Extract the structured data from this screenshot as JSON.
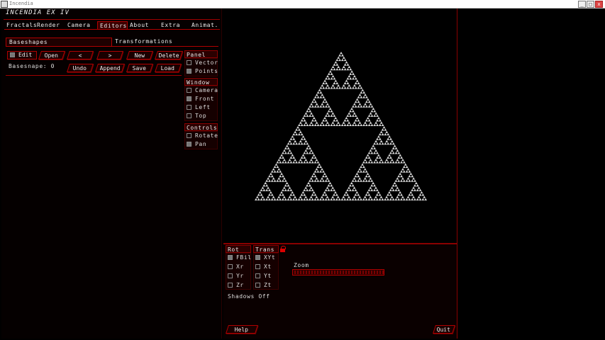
{
  "window": {
    "title": "Incendia",
    "btn_min": "_",
    "btn_max": "□",
    "btn_close": "x"
  },
  "app_title": "INCENDIA EX IV",
  "tabs": [
    "Fractals",
    "Render",
    "Camera",
    "Editors",
    "About",
    "Extra",
    "Animat."
  ],
  "subtabs": [
    "Baseshapes",
    "Transformations"
  ],
  "editor": {
    "edit_label": "Edit",
    "basesnape_label": "Basesnape: 0",
    "buttons_row1": [
      "Open",
      "<",
      ">",
      "New",
      "Delete"
    ],
    "buttons_row2": [
      "Undo",
      "Append",
      "Save",
      "Load"
    ]
  },
  "panel": {
    "title": "Panel",
    "options": [
      "Vector",
      "Points"
    ]
  },
  "window_group": {
    "title": "Window",
    "options": [
      "Camera",
      "Front",
      "Left",
      "Top"
    ]
  },
  "controls": {
    "title": "Controls",
    "options": [
      "Rotate",
      "Pan"
    ]
  },
  "bottom": {
    "rot_title": "Rot",
    "rot_options": [
      "FBil",
      "Xr",
      "Yr",
      "Zr"
    ],
    "trans_title": "Trans",
    "trans_options": [
      "XYt",
      "Xt",
      "Yt",
      "Zt"
    ],
    "zoom_label": "Zoom",
    "shadows_label": "Shadows",
    "shadows_value": "Off",
    "help_label": "Help",
    "quit_label": "Quit"
  },
  "colors": {
    "accent": "#b00000",
    "background": "#000000",
    "fractal": "#d8d8d8"
  }
}
